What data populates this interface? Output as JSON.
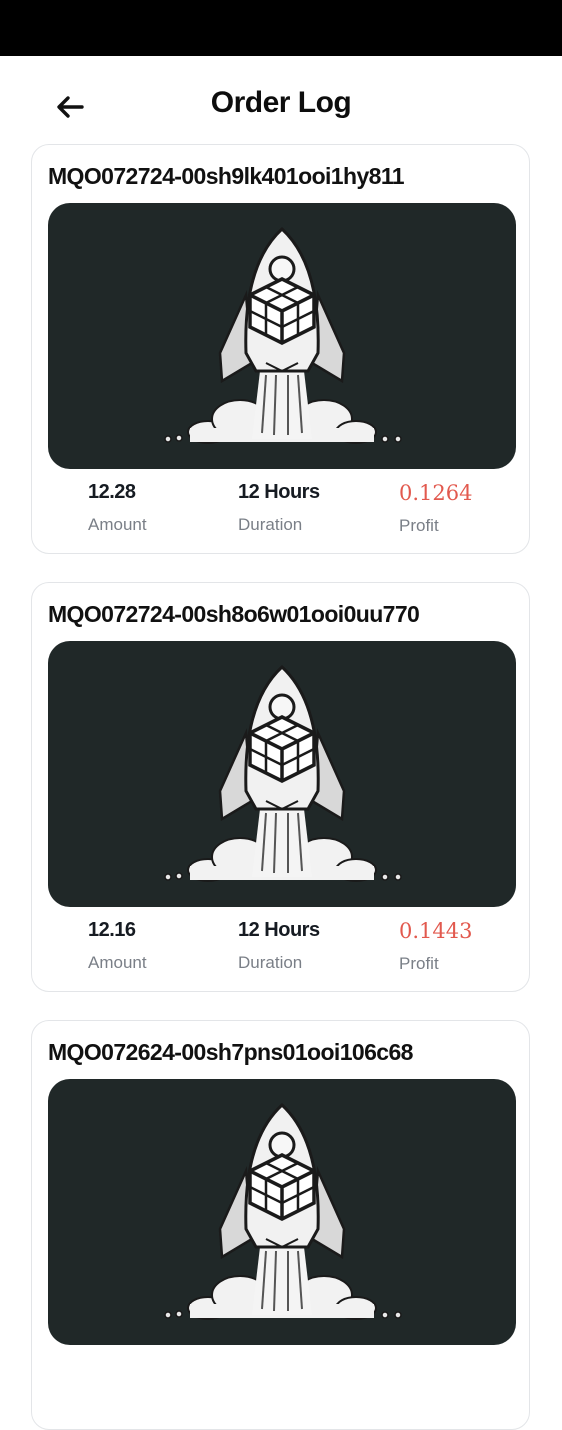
{
  "header": {
    "back_icon": "arrow-left-icon",
    "title": "Order Log"
  },
  "colors": {
    "profit": "#e2594e",
    "image_background": "#202828",
    "status_bar": "#000000"
  },
  "orders": [
    {
      "id": "MQO072724-00sh9lk401ooi1hy811",
      "amount": "12.28",
      "duration": "12 Hours",
      "profit": "0.1264",
      "image_icon": "rocket-icon"
    },
    {
      "id": "MQO072724-00sh8o6w01ooi0uu770",
      "amount": "12.16",
      "duration": "12 Hours",
      "profit": "0.1443",
      "image_icon": "rocket-icon"
    },
    {
      "id": "MQO072624-00sh7pns01ooi106c68",
      "image_icon": "rocket-icon"
    }
  ],
  "labels": {
    "amount": "Amount",
    "duration": "Duration",
    "profit": "Profit"
  }
}
